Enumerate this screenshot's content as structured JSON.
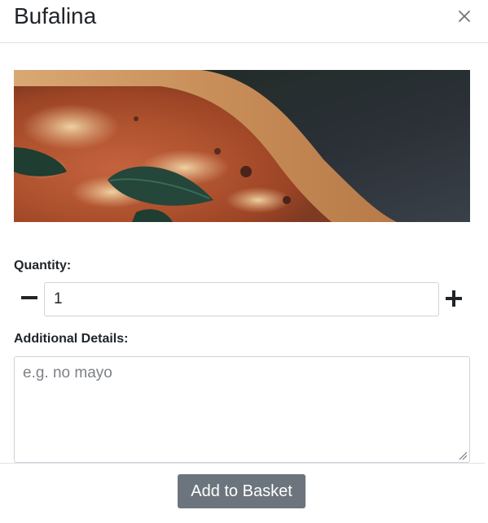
{
  "modal": {
    "title": "Bufalina",
    "close_icon": "close-icon"
  },
  "image": {
    "alt": "Pizza"
  },
  "quantity": {
    "label": "Quantity:",
    "value": "1",
    "minus_icon": "minus-icon",
    "plus_icon": "plus-icon"
  },
  "details": {
    "label": "Additional Details:",
    "placeholder": "e.g. no mayo",
    "value": ""
  },
  "footer": {
    "add_label": "Add to Basket"
  },
  "colors": {
    "button_bg": "#6c757d",
    "border": "#dee2e6",
    "input_border": "#ced4da"
  }
}
